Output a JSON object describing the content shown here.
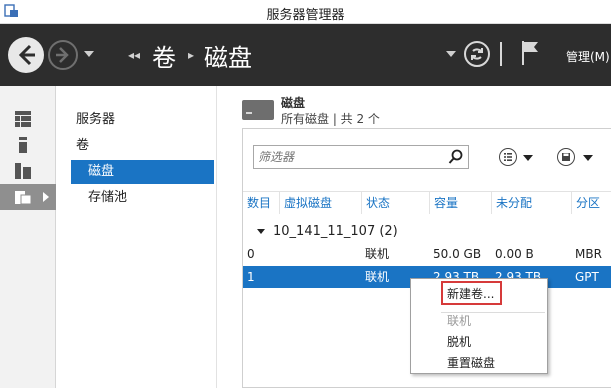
{
  "window": {
    "title": "服务器管理器"
  },
  "topbar": {
    "breadcrumb": [
      {
        "label": "卷"
      },
      {
        "label": "磁盘"
      }
    ],
    "manage_label": "管理(M)"
  },
  "left_rail": {
    "items": [
      {
        "icon": "dashboard-icon",
        "selected": false
      },
      {
        "icon": "local-server-icon",
        "selected": false
      },
      {
        "icon": "all-servers-icon",
        "selected": false
      },
      {
        "icon": "file-storage-icon",
        "selected": true
      }
    ]
  },
  "nav": {
    "items": [
      {
        "label": "服务器",
        "selected": false,
        "indent": false
      },
      {
        "label": "卷",
        "selected": false,
        "indent": false
      },
      {
        "label": "磁盘",
        "selected": true,
        "indent": true
      },
      {
        "label": "存储池",
        "selected": false,
        "indent": true
      }
    ]
  },
  "section": {
    "title": "磁盘",
    "subtitle": "所有磁盘 | 共 2 个"
  },
  "filter": {
    "placeholder": "筛选器"
  },
  "table": {
    "columns": [
      "数目",
      "虚拟磁盘",
      "状态",
      "容量",
      "未分配",
      "分区"
    ],
    "group_label": "10_141_11_107 (2)",
    "rows": [
      {
        "number": "0",
        "virtual_disk": "",
        "status": "联机",
        "capacity": "50.0 GB",
        "unallocated": "0.00 B",
        "partition": "MBR",
        "selected": false
      },
      {
        "number": "1",
        "virtual_disk": "",
        "status": "联机",
        "capacity": "2.93 TB",
        "unallocated": "2.93 TB",
        "partition": "GPT",
        "selected": true
      }
    ]
  },
  "context_menu": {
    "items": [
      {
        "label": "新建卷...",
        "disabled": false,
        "highlighted": true
      },
      {
        "label": "联机",
        "disabled": true
      },
      {
        "label": "脱机",
        "disabled": false
      },
      {
        "label": "重置磁盘",
        "disabled": false
      }
    ]
  },
  "colors": {
    "accent": "#1a74c4",
    "topbar": "#2d2d2d",
    "highlight_box": "#d63a3a"
  }
}
